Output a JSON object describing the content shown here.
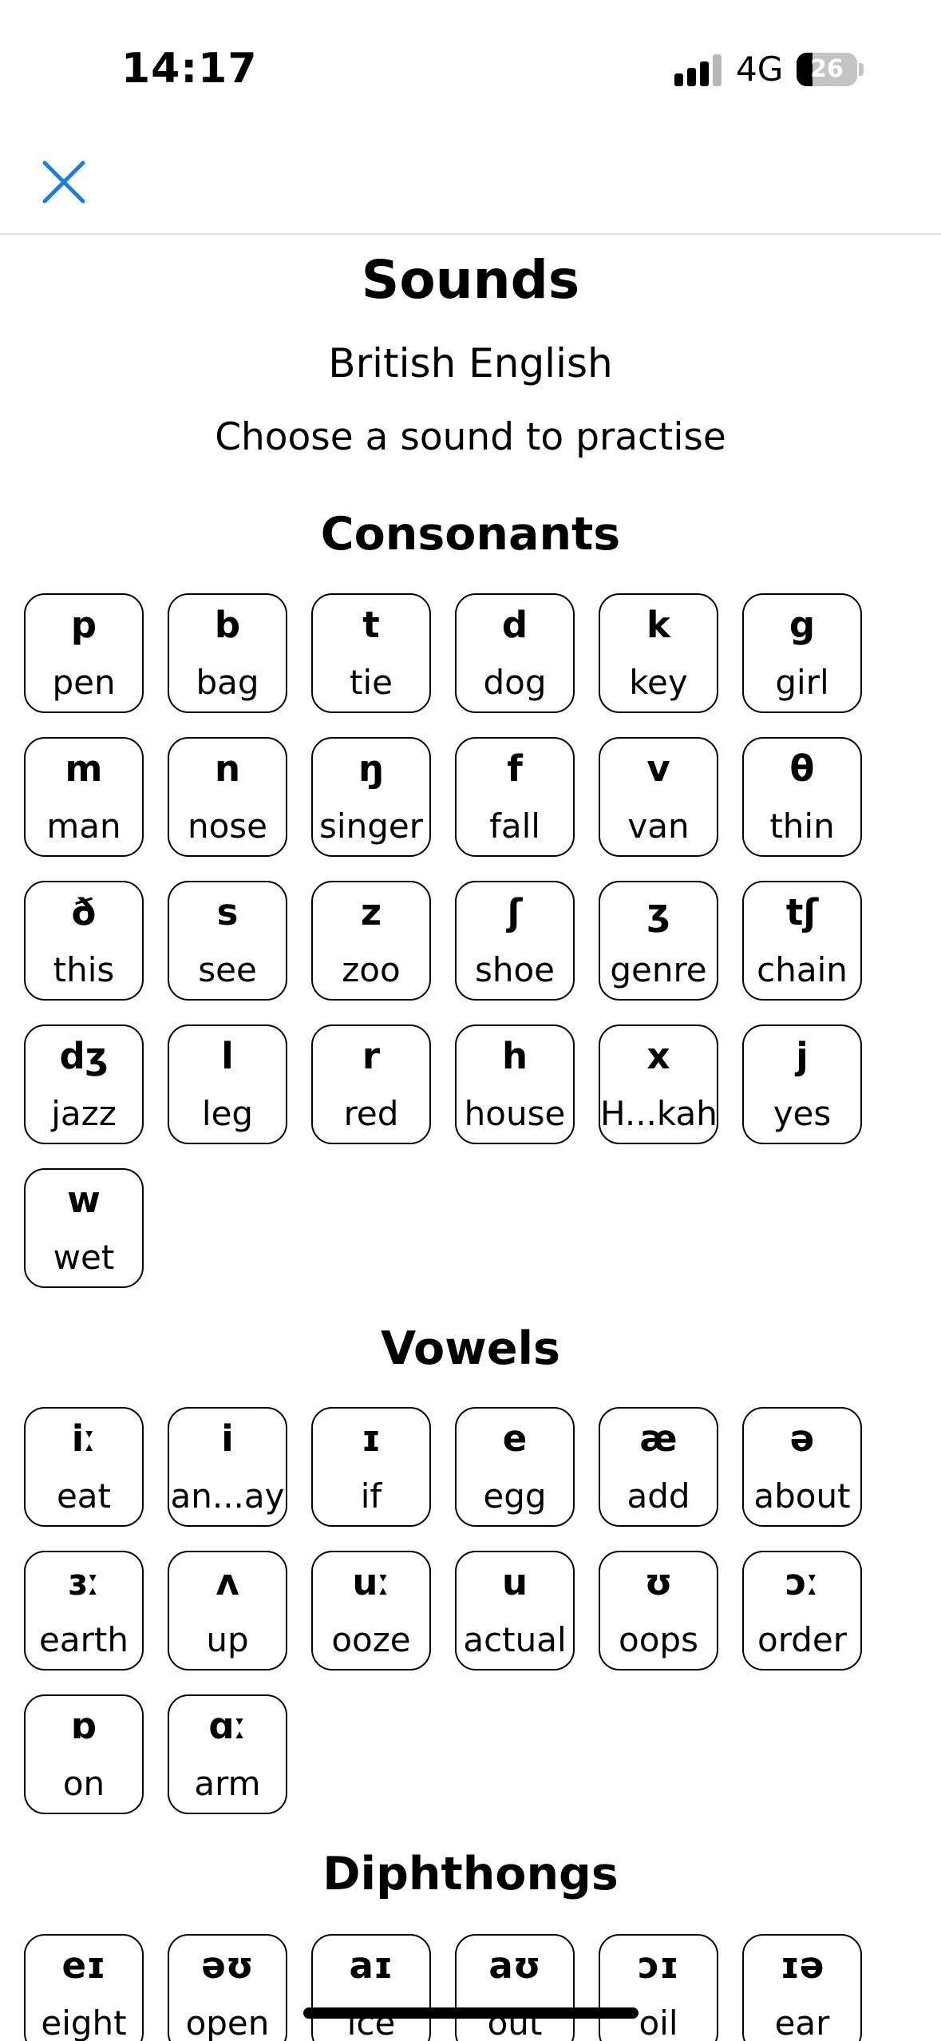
{
  "status_bar": {
    "time": "14:17",
    "network": "4G",
    "battery_level": "26",
    "battery_fraction": 0.26,
    "signal_bars_filled": 3,
    "signal_bars_total": 4
  },
  "nav": {
    "close_icon": "close-icon",
    "accent_color": "#1a7fe0"
  },
  "header": {
    "title": "Sounds",
    "subtitle": "British English",
    "instruction": "Choose a sound to practise"
  },
  "sections": [
    {
      "title": "Consonants",
      "sounds": [
        {
          "symbol": "p",
          "word": "pen"
        },
        {
          "symbol": "b",
          "word": "bag"
        },
        {
          "symbol": "t",
          "word": "tie"
        },
        {
          "symbol": "d",
          "word": "dog"
        },
        {
          "symbol": "k",
          "word": "key"
        },
        {
          "symbol": "g",
          "word": "girl"
        },
        {
          "symbol": "m",
          "word": "man"
        },
        {
          "symbol": "n",
          "word": "nose"
        },
        {
          "symbol": "ŋ",
          "word": "singer"
        },
        {
          "symbol": "f",
          "word": "fall"
        },
        {
          "symbol": "v",
          "word": "van"
        },
        {
          "symbol": "θ",
          "word": "thin"
        },
        {
          "symbol": "ð",
          "word": "this"
        },
        {
          "symbol": "s",
          "word": "see"
        },
        {
          "symbol": "z",
          "word": "zoo"
        },
        {
          "symbol": "ʃ",
          "word": "shoe"
        },
        {
          "symbol": "ʒ",
          "word": "genre"
        },
        {
          "symbol": "tʃ",
          "word": "chain"
        },
        {
          "symbol": "dʒ",
          "word": "jazz"
        },
        {
          "symbol": "l",
          "word": "leg"
        },
        {
          "symbol": "r",
          "word": "red"
        },
        {
          "symbol": "h",
          "word": "house"
        },
        {
          "symbol": "x",
          "word": "H...kah"
        },
        {
          "symbol": "j",
          "word": "yes"
        },
        {
          "symbol": "w",
          "word": "wet"
        }
      ]
    },
    {
      "title": "Vowels",
      "sounds": [
        {
          "symbol": "iː",
          "word": "eat"
        },
        {
          "symbol": "i",
          "word": "an...ay"
        },
        {
          "symbol": "ɪ",
          "word": "if"
        },
        {
          "symbol": "e",
          "word": "egg"
        },
        {
          "symbol": "æ",
          "word": "add"
        },
        {
          "symbol": "ə",
          "word": "about"
        },
        {
          "symbol": "ɜː",
          "word": "earth"
        },
        {
          "symbol": "ʌ",
          "word": "up"
        },
        {
          "symbol": "uː",
          "word": "ooze"
        },
        {
          "symbol": "u",
          "word": "actual"
        },
        {
          "symbol": "ʊ",
          "word": "oops"
        },
        {
          "symbol": "ɔː",
          "word": "order"
        },
        {
          "symbol": "ɒ",
          "word": "on"
        },
        {
          "symbol": "ɑː",
          "word": "arm"
        }
      ]
    },
    {
      "title": "Diphthongs",
      "sounds": [
        {
          "symbol": "eɪ",
          "word": "eight"
        },
        {
          "symbol": "əʊ",
          "word": "open"
        },
        {
          "symbol": "aɪ",
          "word": "ice"
        },
        {
          "symbol": "aʊ",
          "word": "out"
        },
        {
          "symbol": "ɔɪ",
          "word": "oil"
        },
        {
          "symbol": "ɪə",
          "word": "ear"
        }
      ]
    }
  ]
}
